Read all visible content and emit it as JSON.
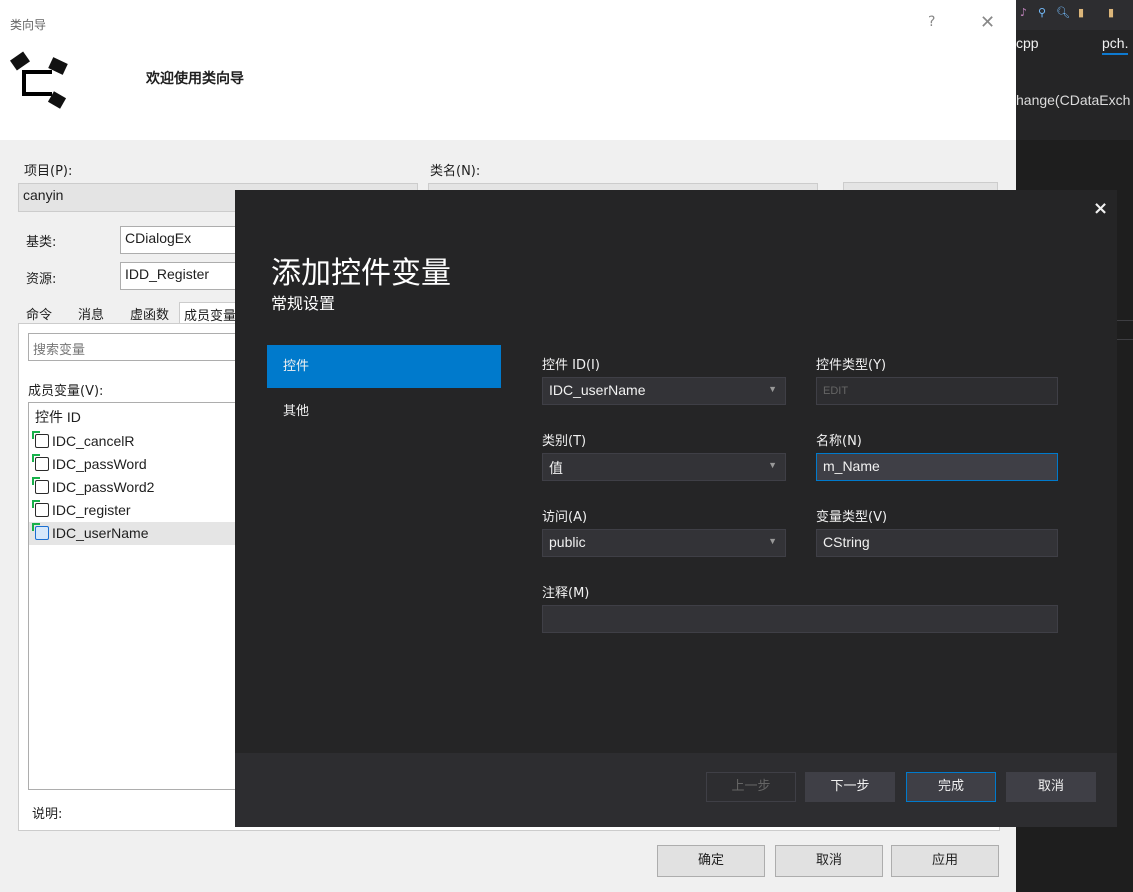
{
  "ide": {
    "tabs": [
      "cpp",
      "pch."
    ],
    "code_snippet": "hange(CDataExch"
  },
  "wizard": {
    "title": "类向导",
    "help": "?",
    "close": "✕",
    "welcome": "欢迎使用类向导",
    "project_label": "项目(P):",
    "project_value": "canyin",
    "classname_label": "类名(N):",
    "base_label": "基类:",
    "base_value": "CDialogEx",
    "resource_label": "资源:",
    "resource_value": "IDD_Register",
    "tabs": [
      "命令",
      "消息",
      "虚函数",
      "成员变量"
    ],
    "search_placeholder": "搜索变量",
    "members_label": "成员变量(V):",
    "list_header": "控件 ID",
    "list_items": [
      "IDC_cancelR",
      "IDC_passWord",
      "IDC_passWord2",
      "IDC_register",
      "IDC_userName"
    ],
    "description_label": "说明:",
    "buttons": {
      "ok": "确定",
      "cancel": "取消",
      "apply": "应用"
    }
  },
  "modal": {
    "close": "×",
    "title": "添加控件变量",
    "subtitle": "常规设置",
    "nav": [
      "控件",
      "其他"
    ],
    "control_id_label": "控件 ID(I)",
    "control_id_value": "IDC_userName",
    "control_type_label": "控件类型(Y)",
    "control_type_value": "EDIT",
    "category_label": "类别(T)",
    "category_value": "值",
    "name_label": "名称(N)",
    "name_value": "m_Name",
    "access_label": "访问(A)",
    "access_value": "public",
    "var_type_label": "变量类型(V)",
    "var_type_value": "CString",
    "comment_label": "注释(M)",
    "comment_value": "",
    "buttons": {
      "prev": "上一步",
      "next": "下一步",
      "finish": "完成",
      "cancel": "取消"
    }
  }
}
